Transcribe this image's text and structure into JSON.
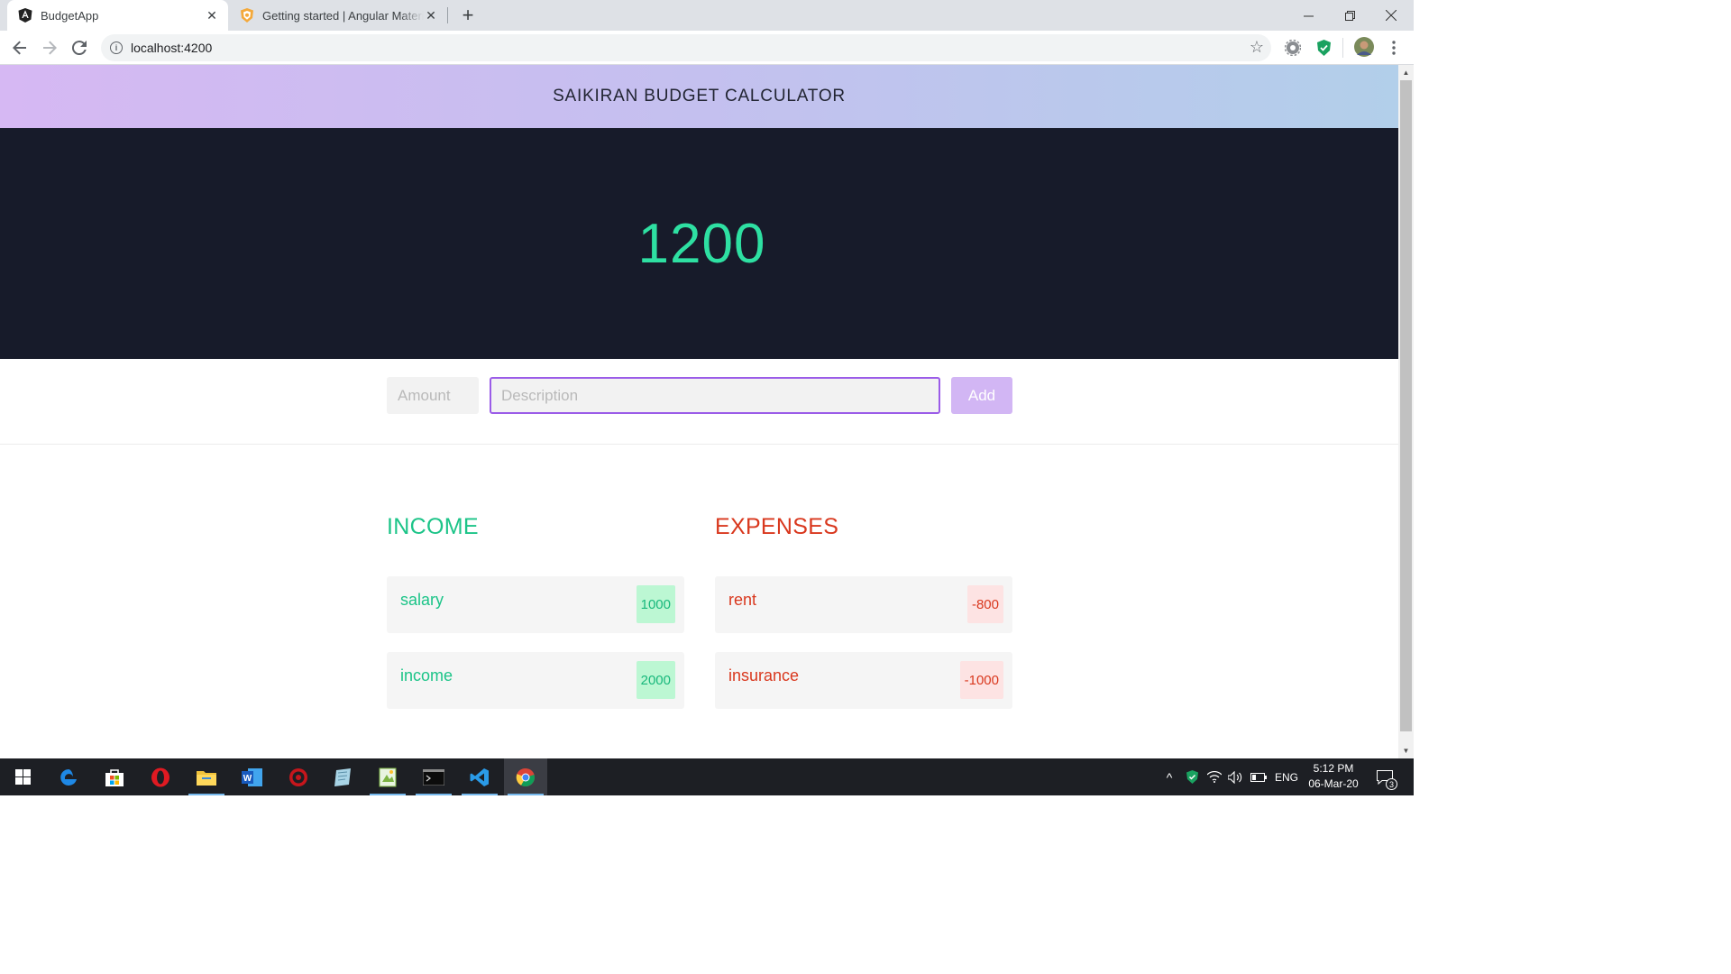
{
  "browser": {
    "tabs": [
      {
        "title": "BudgetApp",
        "active": true
      },
      {
        "title": "Getting started | Angular Material",
        "active": false
      }
    ],
    "url": "localhost:4200"
  },
  "app": {
    "header_title": "SAIKIRAN BUDGET CALCULATOR",
    "total": "1200",
    "form": {
      "amount_placeholder": "Amount",
      "description_placeholder": "Description",
      "add_label": "Add"
    },
    "income": {
      "title": "INCOME",
      "items": [
        {
          "label": "salary",
          "amount": "1000"
        },
        {
          "label": "income",
          "amount": "2000"
        }
      ]
    },
    "expenses": {
      "title": "EXPENSES",
      "items": [
        {
          "label": "rent",
          "amount": "-800"
        },
        {
          "label": "insurance",
          "amount": "-1000"
        }
      ]
    },
    "colors": {
      "income": "#1cc488",
      "expense": "#d9381e",
      "hero_bg": "#171b2a",
      "accent": "#9b5ce8"
    }
  },
  "taskbar": {
    "apps": [
      "start-icon",
      "edge-icon",
      "store-icon",
      "opera-icon",
      "file-explorer-icon",
      "word-icon",
      "game-app-icon",
      "notes-app-icon",
      "editor-app-icon",
      "terminal-icon",
      "vscode-icon",
      "chrome-icon"
    ],
    "language": "ENG",
    "time": "5:12 PM",
    "date": "06-Mar-20",
    "notification_count": "3"
  }
}
